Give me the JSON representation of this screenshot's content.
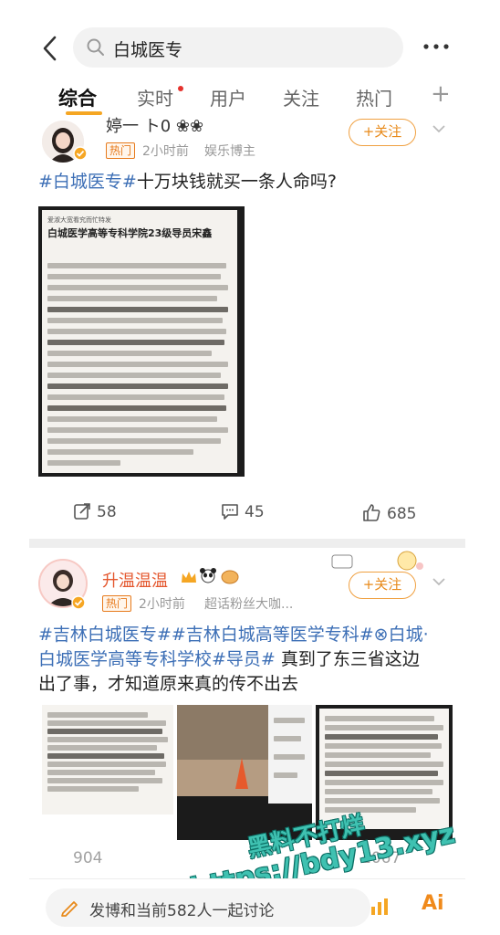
{
  "search": {
    "query": "白城医专"
  },
  "tabs": [
    {
      "label": "综合",
      "active": true
    },
    {
      "label": "实时"
    },
    {
      "label": "用户"
    },
    {
      "label": "关注"
    },
    {
      "label": "热门"
    }
  ],
  "posts": [
    {
      "author": "婷一 ト0 ❀❀",
      "badge": "热门",
      "time": "2小时前",
      "role": "娱乐博主",
      "follow_label": "+关注",
      "text": {
        "tag": "#白城医专#",
        "body": "十万块钱就买一条人命吗?"
      },
      "image_title": "白城医学高等专科学院23级导员宋鑫",
      "image_subtitle": "爱淑大宽看究而忙特发",
      "stats": {
        "reposts": "58",
        "comments": "45",
        "likes": "685"
      }
    },
    {
      "author": "升温温温",
      "badge": "热门",
      "time": "2小时前",
      "role": "超话粉丝大咖...",
      "follow_label": "+关注",
      "text": {
        "tags_line1": "#吉林白城医专##吉林白城高等医学专科#⊗白城·",
        "tags_line2": "白城医学高等专科学校#导员#",
        "body_line2": "真到了东三省这边",
        "body_line3": "出了事，才知道原来真的传不出去"
      },
      "stats": {
        "reposts": "904",
        "comments": "",
        "likes": "1067"
      }
    }
  ],
  "composer": {
    "placeholder": "发博和当前582人一起讨论"
  },
  "footer_icons": [
    "chart-icon",
    "ai-icon"
  ],
  "footer_ai_label": "Ai",
  "watermark": {
    "line1": "黑料不打烊",
    "line2": "https://bdy13.xyz"
  },
  "colors": {
    "accent": "#f5a623",
    "tag": "#3d6fb6",
    "follow": "#e88a1a",
    "watermark": "#3fc1b1"
  }
}
